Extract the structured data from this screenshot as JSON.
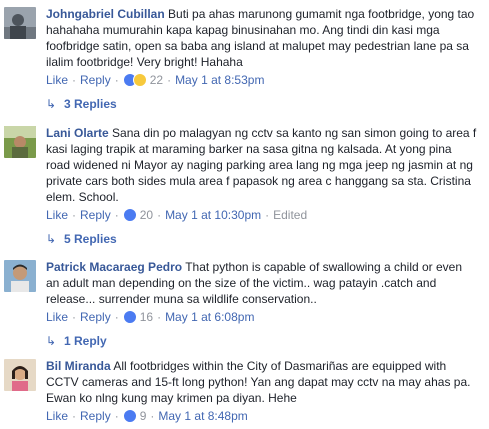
{
  "comments": [
    {
      "author": "Johngabriel Cubillan",
      "text": "Buti pa ahas marunong gumamit nga footbridge, yong tao hahahaha mumurahin kapa kapag binusinahan mo. Ang tindi din kasi mga foofbridge satin, open sa baba ang island at malupet may pedestrian lane pa sa ilalim footbridge! Very bright! Hahaha",
      "like_label": "Like",
      "reply_label": "Reply",
      "reactions": [
        "like",
        "haha"
      ],
      "reaction_count": "22",
      "timestamp": "May 1 at 8:53pm",
      "edited": "",
      "replies_label": "3 Replies"
    },
    {
      "author": "Lani Olarte",
      "text": "Sana din po malagyan ng cctv sa kanto ng san simon going to area f kasi laging trapik at maraming barker na sasa gitna ng kalsada. At yong pina road widened ni Mayor ay naging parking area lang ng mga jeep ng jasmin at ng private cars both sides mula area f papasok ng area c hanggang sa sta. Cristina elem. School.",
      "like_label": "Like",
      "reply_label": "Reply",
      "reactions": [
        "like"
      ],
      "reaction_count": "20",
      "timestamp": "May 1 at 10:30pm",
      "edited": "Edited",
      "replies_label": "5 Replies"
    },
    {
      "author": "Patrick Macaraeg Pedro",
      "text": "That python is capable of swallowing a child or even an adult man depending on the size of the victim.. wag patayin .catch and release... surrender muna sa wildlife conservation..",
      "like_label": "Like",
      "reply_label": "Reply",
      "reactions": [
        "like"
      ],
      "reaction_count": "16",
      "timestamp": "May 1 at 6:08pm",
      "edited": "",
      "replies_label": "1 Reply"
    },
    {
      "author": "Bil Miranda",
      "text": "All footbridges within the City of Dasmariñas are equipped with CCTV cameras and 15-ft long python! Yan ang dapat may cctv na may ahas pa. Ewan ko nlng kung may krimen pa diyan. Hehe",
      "like_label": "Like",
      "reply_label": "Reply",
      "reactions": [
        "like"
      ],
      "reaction_count": "9",
      "timestamp": "May 1 at 8:48pm",
      "edited": "",
      "replies_label": ""
    }
  ],
  "colors": {
    "link": "#4267b2",
    "author": "#385898",
    "meta": "#90949c"
  }
}
